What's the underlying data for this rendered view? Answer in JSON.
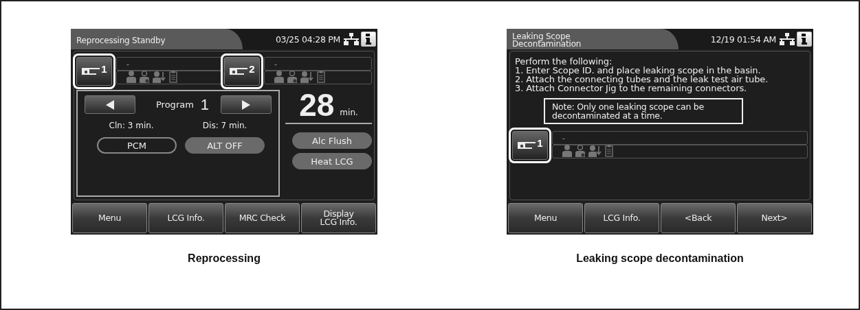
{
  "screens": [
    {
      "kind": "standby",
      "title": "Reprocessing Standby",
      "datetime": "03/25 04:28 PM",
      "scopes": [
        {
          "number": "1",
          "scope_id": "-",
          "highlighted": true
        },
        {
          "number": "2",
          "scope_id": "-",
          "highlighted": true
        }
      ],
      "program": {
        "label": "Program",
        "number": "1",
        "cleaning": "Cln: 3 min.",
        "disinfection": "Dis: 7 min.",
        "toggles": [
          {
            "label": "PCM",
            "on": false
          },
          {
            "label": "ALT OFF",
            "on": true
          }
        ]
      },
      "time": {
        "value": "28",
        "unit": "min."
      },
      "status_buttons": [
        "Alc Flush",
        "Heat LCG"
      ],
      "buttons": [
        "Menu",
        "LCG Info.",
        "MRC Check",
        "Display\nLCG Info."
      ],
      "caption": "Reprocessing"
    },
    {
      "kind": "leak",
      "title": "Leaking Scope\nDecontamination",
      "datetime": "12/19 01:54 AM",
      "instructions": [
        "Perform the following:",
        "1. Enter Scope ID. and place leaking scope in the basin.",
        "2. Attach the connecting tubes and the leak test air tube.",
        "3. Attach Connector Jig to the remaining connectors."
      ],
      "note": "Note: Only one leaking scope can be decontaminated at a time.",
      "scopes": [
        {
          "number": "1",
          "scope_id": "-",
          "highlighted": true
        }
      ],
      "buttons": [
        "Menu",
        "LCG Info.",
        "<Back",
        "Next>"
      ],
      "caption": "Leaking scope decontamination"
    }
  ]
}
